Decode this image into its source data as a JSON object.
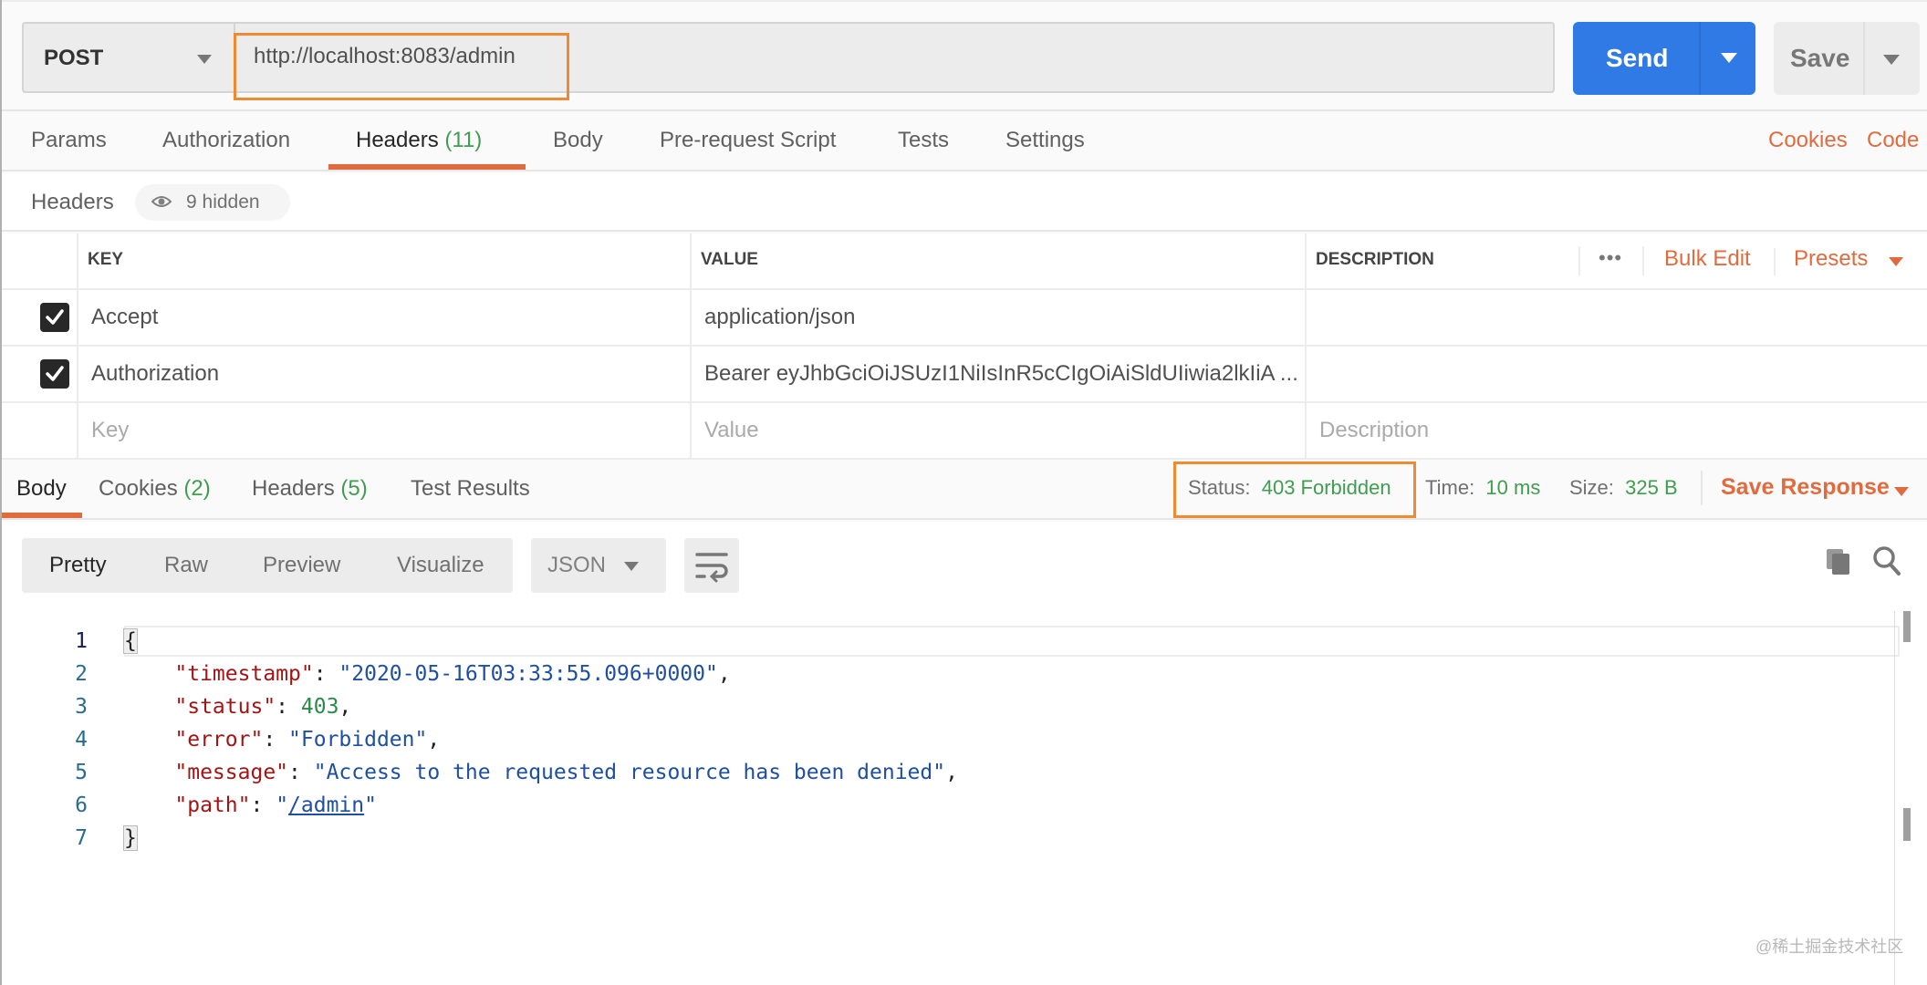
{
  "request": {
    "method": "POST",
    "url": "http://localhost:8083/admin",
    "send_label": "Send",
    "save_label": "Save"
  },
  "request_tabs": [
    {
      "label": "Params",
      "count": null
    },
    {
      "label": "Authorization",
      "count": null
    },
    {
      "label": "Headers",
      "count": "(11)",
      "active": true
    },
    {
      "label": "Body",
      "count": null
    },
    {
      "label": "Pre-request Script",
      "count": null
    },
    {
      "label": "Tests",
      "count": null
    },
    {
      "label": "Settings",
      "count": null
    }
  ],
  "request_links": {
    "cookies": "Cookies",
    "code": "Code"
  },
  "headers_section": {
    "title": "Headers",
    "hidden_label": "9 hidden",
    "columns": {
      "key": "KEY",
      "value": "VALUE",
      "description": "DESCRIPTION"
    },
    "actions": {
      "more": "•••",
      "bulk_edit": "Bulk Edit",
      "presets": "Presets"
    },
    "rows": [
      {
        "checked": true,
        "key": "Accept",
        "value": "application/json",
        "description": ""
      },
      {
        "checked": true,
        "key": "Authorization",
        "value": "Bearer eyJhbGciOiJSUzI1NiIsInR5cCIgOiAiSldUIiwia2lkIiA ...",
        "description": ""
      }
    ],
    "placeholders": {
      "key": "Key",
      "value": "Value",
      "description": "Description"
    }
  },
  "response_tabs": [
    {
      "label": "Body",
      "count": null,
      "active": true
    },
    {
      "label": "Cookies",
      "count": "(2)"
    },
    {
      "label": "Headers",
      "count": "(5)"
    },
    {
      "label": "Test Results",
      "count": null
    }
  ],
  "response_meta": {
    "status_label": "Status:",
    "status_value": "403 Forbidden",
    "time_label": "Time:",
    "time_value": "10 ms",
    "size_label": "Size:",
    "size_value": "325 B",
    "save_response": "Save Response"
  },
  "body_view": {
    "options": [
      "Pretty",
      "Raw",
      "Preview",
      "Visualize"
    ],
    "active": "Pretty",
    "language": "JSON"
  },
  "response_body": {
    "line_numbers": [
      "1",
      "2",
      "3",
      "4",
      "5",
      "6",
      "7"
    ],
    "open_brace": "{",
    "close_brace": "}",
    "fields": [
      {
        "key": "\"timestamp\"",
        "value": "\"2020-05-16T03:33:55.096+0000\"",
        "type": "string",
        "comma": true
      },
      {
        "key": "\"status\"",
        "value": "403",
        "type": "number",
        "comma": true
      },
      {
        "key": "\"error\"",
        "value": "\"Forbidden\"",
        "type": "string",
        "comma": true
      },
      {
        "key": "\"message\"",
        "value": "\"Access to the requested resource has been denied\"",
        "type": "string",
        "comma": true
      },
      {
        "key": "\"path\"",
        "value_prefix": "\"",
        "value": "/admin",
        "value_suffix": "\"",
        "type": "link",
        "comma": false
      }
    ]
  },
  "watermark": "@稀土掘金技术社区",
  "colors": {
    "accent_orange": "#e06b3e",
    "send_blue": "#2f7ae5",
    "success_green": "#3f9d4f",
    "highlight_box": "#f08a32"
  }
}
